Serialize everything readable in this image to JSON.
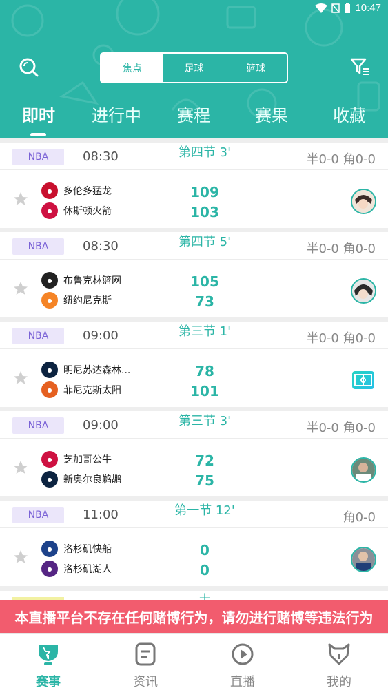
{
  "status_bar": {
    "time": "10:47"
  },
  "header": {
    "segments": [
      {
        "label": "焦点",
        "active": true
      },
      {
        "label": "足球",
        "active": false
      },
      {
        "label": "篮球",
        "active": false
      }
    ],
    "tabs": [
      {
        "label": "即时",
        "active": true
      },
      {
        "label": "进行中",
        "active": false
      },
      {
        "label": "赛程",
        "active": false
      },
      {
        "label": "赛果",
        "active": false
      },
      {
        "label": "收藏",
        "active": false
      }
    ]
  },
  "matches": [
    {
      "league": "NBA",
      "time": "08:30",
      "period": "第四节 3'",
      "meta": "半0-0 角0-0",
      "home": {
        "name": "多伦多猛龙",
        "color": "#c8102e"
      },
      "away": {
        "name": "休斯顿火箭",
        "color": "#ce1141"
      },
      "home_score": "109",
      "away_score": "103",
      "icon": "avatar-anime-icon"
    },
    {
      "league": "NBA",
      "time": "08:30",
      "period": "第四节 5'",
      "meta": "半0-0 角0-0",
      "home": {
        "name": "布鲁克林篮网",
        "color": "#222222"
      },
      "away": {
        "name": "纽约尼克斯",
        "color": "#f58426"
      },
      "home_score": "105",
      "away_score": "73",
      "icon": "avatar-anime-icon"
    },
    {
      "league": "NBA",
      "time": "09:00",
      "period": "第三节 1'",
      "meta": "半0-0 角0-0",
      "home": {
        "name": "明尼苏达森林...",
        "color": "#0c2340"
      },
      "away": {
        "name": "菲尼克斯太阳",
        "color": "#e56020"
      },
      "home_score": "78",
      "away_score": "101",
      "icon": "live-court-icon"
    },
    {
      "league": "NBA",
      "time": "09:00",
      "period": "第三节 3'",
      "meta": "半0-0 角0-0",
      "home": {
        "name": "芝加哥公牛",
        "color": "#ce1141"
      },
      "away": {
        "name": "新奥尔良鹈鹕",
        "color": "#0c2340"
      },
      "home_score": "72",
      "away_score": "75",
      "icon": "avatar-player-icon"
    },
    {
      "league": "NBA",
      "time": "11:00",
      "period": "第一节 12'",
      "meta": "角0-0",
      "home": {
        "name": "洛杉矶快船",
        "color": "#1d428a"
      },
      "away": {
        "name": "洛杉矶湖人",
        "color": "#552583"
      },
      "home_score": "0",
      "away_score": "0",
      "icon": "avatar-player-icon"
    }
  ],
  "partial_next": {
    "period_glyph": "十"
  },
  "warning": "本直播平台不存在任何赌博行为，请勿进行赌博等违法行为",
  "bottom_nav": [
    {
      "label": "赛事",
      "icon": "trophy-icon",
      "active": true
    },
    {
      "label": "资讯",
      "icon": "news-icon",
      "active": false
    },
    {
      "label": "直播",
      "icon": "play-icon",
      "active": false
    },
    {
      "label": "我的",
      "icon": "fox-icon",
      "active": false
    }
  ],
  "colors": {
    "primary": "#2bb5a6",
    "warning": "#f25c6e",
    "league_bg": "#ebe6fa",
    "league_text": "#7a62d6"
  }
}
